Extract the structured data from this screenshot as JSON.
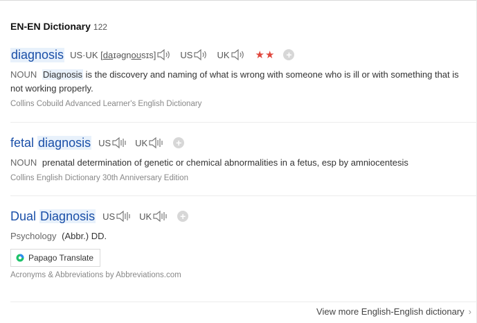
{
  "header": {
    "title": "EN-EN Dictionary",
    "count": "122"
  },
  "entries": [
    {
      "word": "diagnosis",
      "pron_prefix": "US·UK [",
      "pron_a": "da",
      "pron_b": "ɪə",
      "pron_c": "gn",
      "pron_d": "oʊ",
      "pron_e": "sɪs]",
      "us": "US",
      "uk": "UK",
      "stars": "★★",
      "pos": "NOUN",
      "def_highlight": "Diagnosis",
      "def_rest": " is the discovery and naming of what is wrong with someone who is ill or with something that is not working properly.",
      "source": "Collins Cobuild Advanced Learner's English Dictionary"
    },
    {
      "word_a": "fetal",
      "word_b": "diagnosis",
      "us": "US",
      "uk": "UK",
      "pos": "NOUN",
      "def": "prenatal determination of genetic or chemical abnormalities in a fetus, esp by amniocentesis",
      "source": "Collins English Dictionary 30th Anniversary Edition"
    },
    {
      "word_a": "Dual",
      "word_b": "Diagnosis",
      "us": "US",
      "uk": "UK",
      "pos": "Psychology",
      "def": "(Abbr.) DD.",
      "translate_label": "Papago Translate",
      "source": "Acronyms & Abbreviations by Abbreviations.com"
    }
  ],
  "footer": {
    "more_label": "View more English-English dictionary"
  },
  "colors": {
    "link": "#1a4fa8",
    "star": "#e0463c",
    "highlight": "#e8f1fb"
  }
}
